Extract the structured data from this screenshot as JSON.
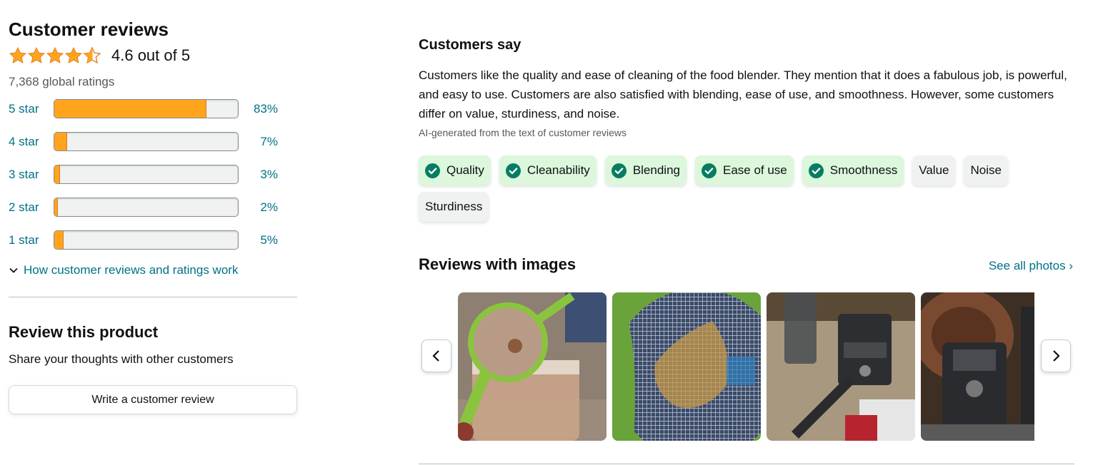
{
  "summary_panel": {
    "title": "Customer reviews",
    "rating_text": "4.6 out of 5",
    "rating_value": 4.6,
    "global_ratings": "7,368 global ratings",
    "histogram": [
      {
        "label": "5 star",
        "pct_text": "83%",
        "fraction": 0.83
      },
      {
        "label": "4 star",
        "pct_text": "7%",
        "fraction": 0.07
      },
      {
        "label": "3 star",
        "pct_text": "3%",
        "fraction": 0.03
      },
      {
        "label": "2 star",
        "pct_text": "2%",
        "fraction": 0.02
      },
      {
        "label": "1 star",
        "pct_text": "5%",
        "fraction": 0.05
      }
    ],
    "how_link": "How customer reviews and ratings work"
  },
  "review_product": {
    "title": "Review this product",
    "subtitle": "Share your thoughts with other customers",
    "button": "Write a customer review"
  },
  "customers_say": {
    "title": "Customers say",
    "summary": "Customers like the quality and ease of cleaning of the food blender. They mention that it does a fabulous job, is powerful, and easy to use. Customers are also satisfied with blending, ease of use, and smoothness. However, some customers differ on value, sturdiness, and noise.",
    "ai_note": "AI-generated from the text of customer reviews",
    "chips": [
      {
        "label": "Quality",
        "sentiment": "positive"
      },
      {
        "label": "Cleanability",
        "sentiment": "positive"
      },
      {
        "label": "Blending",
        "sentiment": "positive"
      },
      {
        "label": "Ease of use",
        "sentiment": "positive"
      },
      {
        "label": "Smoothness",
        "sentiment": "positive"
      },
      {
        "label": "Value",
        "sentiment": "mixed"
      },
      {
        "label": "Noise",
        "sentiment": "mixed"
      },
      {
        "label": "Sturdiness",
        "sentiment": "mixed"
      }
    ]
  },
  "reviews_with_images": {
    "title": "Reviews with images",
    "see_all": "See all photos",
    "images": [
      {
        "name": "strainer-photo"
      },
      {
        "name": "mesh-strainer-closeup-photo"
      },
      {
        "name": "blender-unboxing-photo"
      },
      {
        "name": "blender-on-counter-photo"
      }
    ]
  },
  "colors": {
    "link": "#007185",
    "star": "#ffa41c",
    "positive_chip": "#dcf7dc",
    "check": "#067d62"
  },
  "icons": [
    "star-icon",
    "chevron-down-icon",
    "check-circle-icon",
    "chevron-left-icon",
    "chevron-right-icon"
  ]
}
